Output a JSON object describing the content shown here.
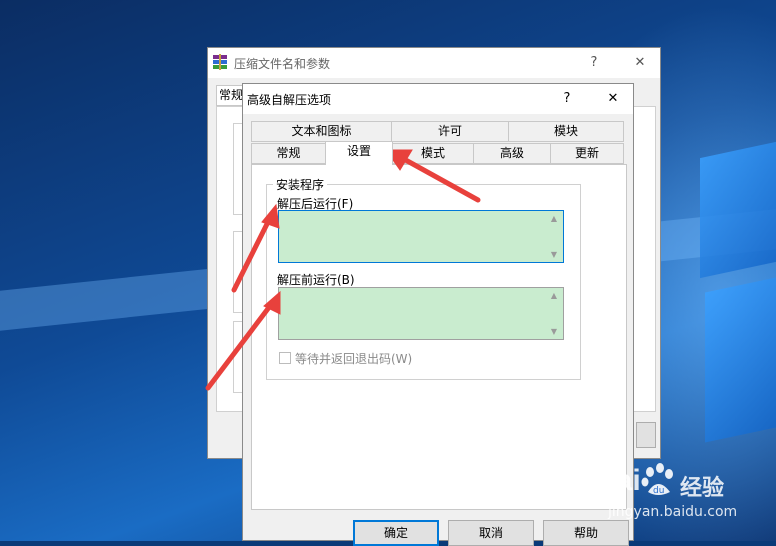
{
  "colors": {
    "accent": "#0078d7",
    "annotation_arrow": "#e8413c",
    "textarea_bg": "#c9eccf"
  },
  "back_window": {
    "title": "压缩文件名和参数",
    "help_symbol": "?",
    "close_symbol": "✕",
    "tab_partial": "常规",
    "icon": "winrar-books-icon"
  },
  "dialog": {
    "title": "高级自解压选项",
    "help_symbol": "?",
    "close_symbol": "✕",
    "tabs_row1": [
      "文本和图标",
      "许可",
      "模块"
    ],
    "tabs_row2": [
      "常规",
      "设置",
      "模式",
      "高级",
      "更新"
    ],
    "active_tab": "设置",
    "group_title": "安装程序",
    "run_after_label": "解压后运行(F)",
    "run_after_value": "",
    "run_before_label": "解压前运行(B)",
    "run_before_value": "",
    "wait_checkbox_label": "等待并返回退出码(W)",
    "wait_checkbox_checked": false,
    "buttons": {
      "ok": "确定",
      "cancel": "取消",
      "help": "帮助"
    }
  },
  "watermark": {
    "brand": "Bai",
    "brand_suffix": "经验",
    "url": "jingyan.baidu.com"
  }
}
